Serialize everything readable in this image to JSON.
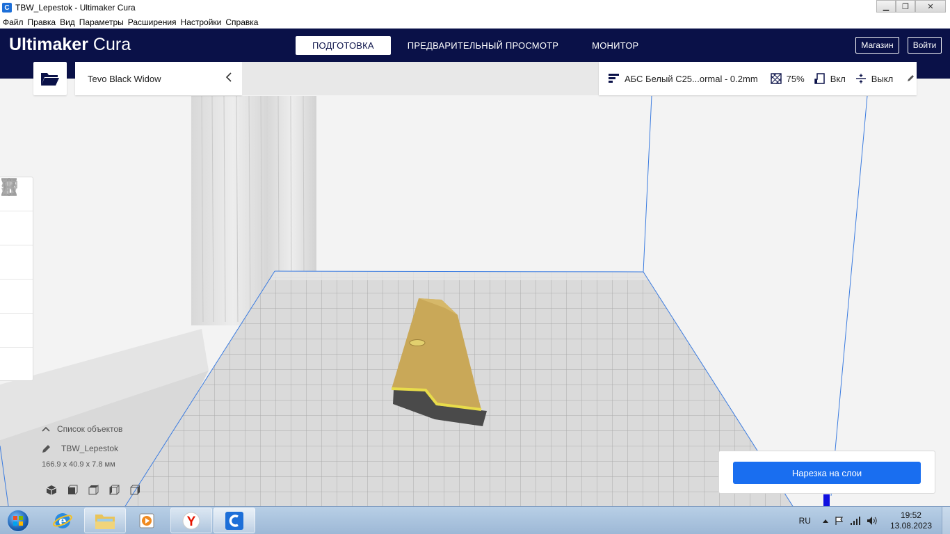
{
  "window": {
    "title": "TBW_Lepestok - Ultimaker Cura",
    "app_icon_letter": "C",
    "minimize": "▁",
    "maximize": "❐",
    "close": "✕"
  },
  "menubar": {
    "items": [
      "Файл",
      "Правка",
      "Вид",
      "Параметры",
      "Расширения",
      "Настройки",
      "Справка"
    ]
  },
  "header": {
    "brand_bold": "Ultimaker",
    "brand_light": "Cura",
    "tabs": [
      {
        "label": "ПОДГОТОВКА",
        "active": true
      },
      {
        "label": "ПРЕДВАРИТЕЛЬНЫЙ ПРОСМОТР",
        "active": false
      },
      {
        "label": "МОНИТОР",
        "active": false
      }
    ],
    "marketplace_label": "Магазин",
    "signin_label": "Войти"
  },
  "toolbar": {
    "printer_name": "Tevo Black Widow",
    "profile": "АБС Белый С25...ormal - 0.2mm",
    "infill": "75%",
    "support": "Вкл",
    "adhesion": "Выкл"
  },
  "tools": [
    "move-tool",
    "scale-tool",
    "rotate-tool",
    "mirror-tool",
    "per-model-settings-tool",
    "support-blocker-tool"
  ],
  "object_list": {
    "header": "Список объектов",
    "object_name": "TBW_Lepestok",
    "dimensions": "166.9 x 40.9 x 7.8 мм"
  },
  "slice": {
    "label": "Нарезка на слои"
  },
  "taskbar": {
    "language": "RU",
    "time": "19:52",
    "date": "13.08.2023"
  },
  "colors": {
    "header_bg": "#0a1148",
    "accent": "#196ef0",
    "model_yellow": "#c9a858",
    "build_volume_line": "#3a7be0"
  }
}
